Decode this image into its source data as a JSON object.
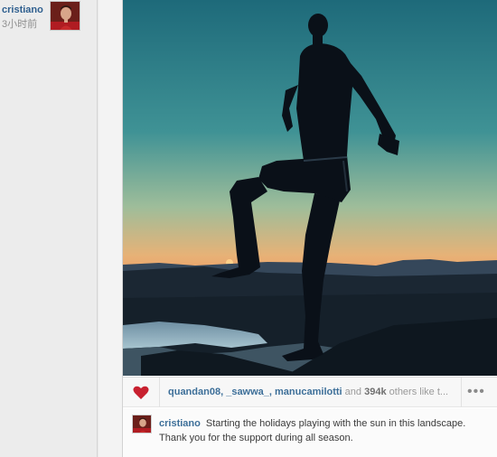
{
  "author": {
    "username": "cristiano",
    "time_ago": "3小时前"
  },
  "likes": {
    "users": [
      "quandan08",
      "_sawwa_",
      "manucamilotti"
    ],
    "and_word": "and",
    "count": "394k",
    "suffix": "others like t..."
  },
  "caption": {
    "username": "cristiano",
    "text": "Starting the holidays playing with the sun in this landscape. Thank you for the support during all season."
  },
  "more_glyph": "•••",
  "colors": {
    "link": "#3d6f99",
    "heart": "#c8202f"
  },
  "icons": {
    "like": "heart-icon",
    "more": "more-dots-icon"
  }
}
